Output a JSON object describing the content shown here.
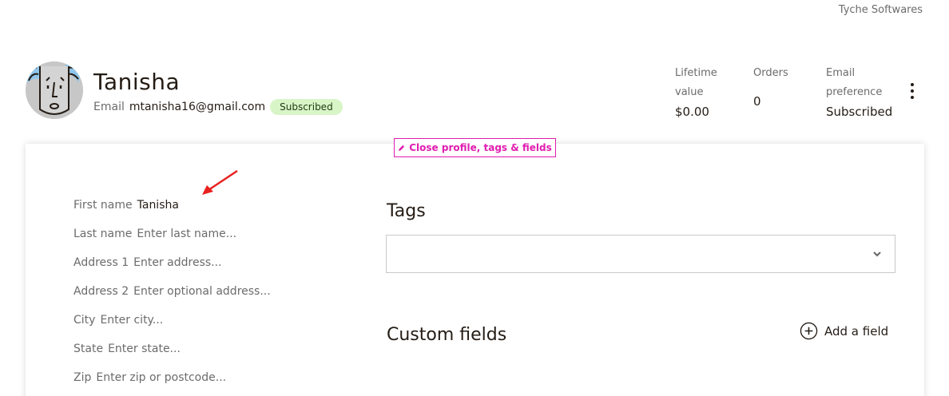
{
  "header": {
    "account_name": "Tyche Softwares"
  },
  "contact": {
    "name": "Tanisha",
    "email_label": "Email",
    "email": "mtanisha16@gmail.com",
    "status": "Subscribed"
  },
  "stats": {
    "lifetime_label_1": "Lifetime",
    "lifetime_label_2": "value",
    "lifetime_value": "$0.00",
    "orders_label": "Orders",
    "orders_value": "0",
    "email_pref_label_1": "Email",
    "email_pref_label_2": "preference",
    "email_pref_value": "Subscribed"
  },
  "actions": {
    "close_profile": "Close profile, tags & fields"
  },
  "fields": {
    "first_name": {
      "label": "First name",
      "value": "Tanisha"
    },
    "last_name": {
      "label": "Last name",
      "placeholder": "Enter last name..."
    },
    "address1": {
      "label": "Address 1",
      "placeholder": "Enter address..."
    },
    "address2": {
      "label": "Address 2",
      "placeholder": "Enter optional address..."
    },
    "city": {
      "label": "City",
      "placeholder": "Enter city..."
    },
    "state": {
      "label": "State",
      "placeholder": "Enter state..."
    },
    "zip": {
      "label": "Zip",
      "placeholder": "Enter zip or postcode..."
    }
  },
  "tags": {
    "title": "Tags"
  },
  "custom_fields": {
    "title": "Custom fields",
    "add_label": "Add a field"
  },
  "colors": {
    "accent": "#e01db0",
    "badge_bg": "#d8f5c7",
    "annotation_arrow": "#e8201f"
  },
  "icons": [
    "avatar-face-icon",
    "pencil-icon",
    "chevron-down-icon",
    "plus-circle-icon",
    "more-vertical-icon"
  ]
}
